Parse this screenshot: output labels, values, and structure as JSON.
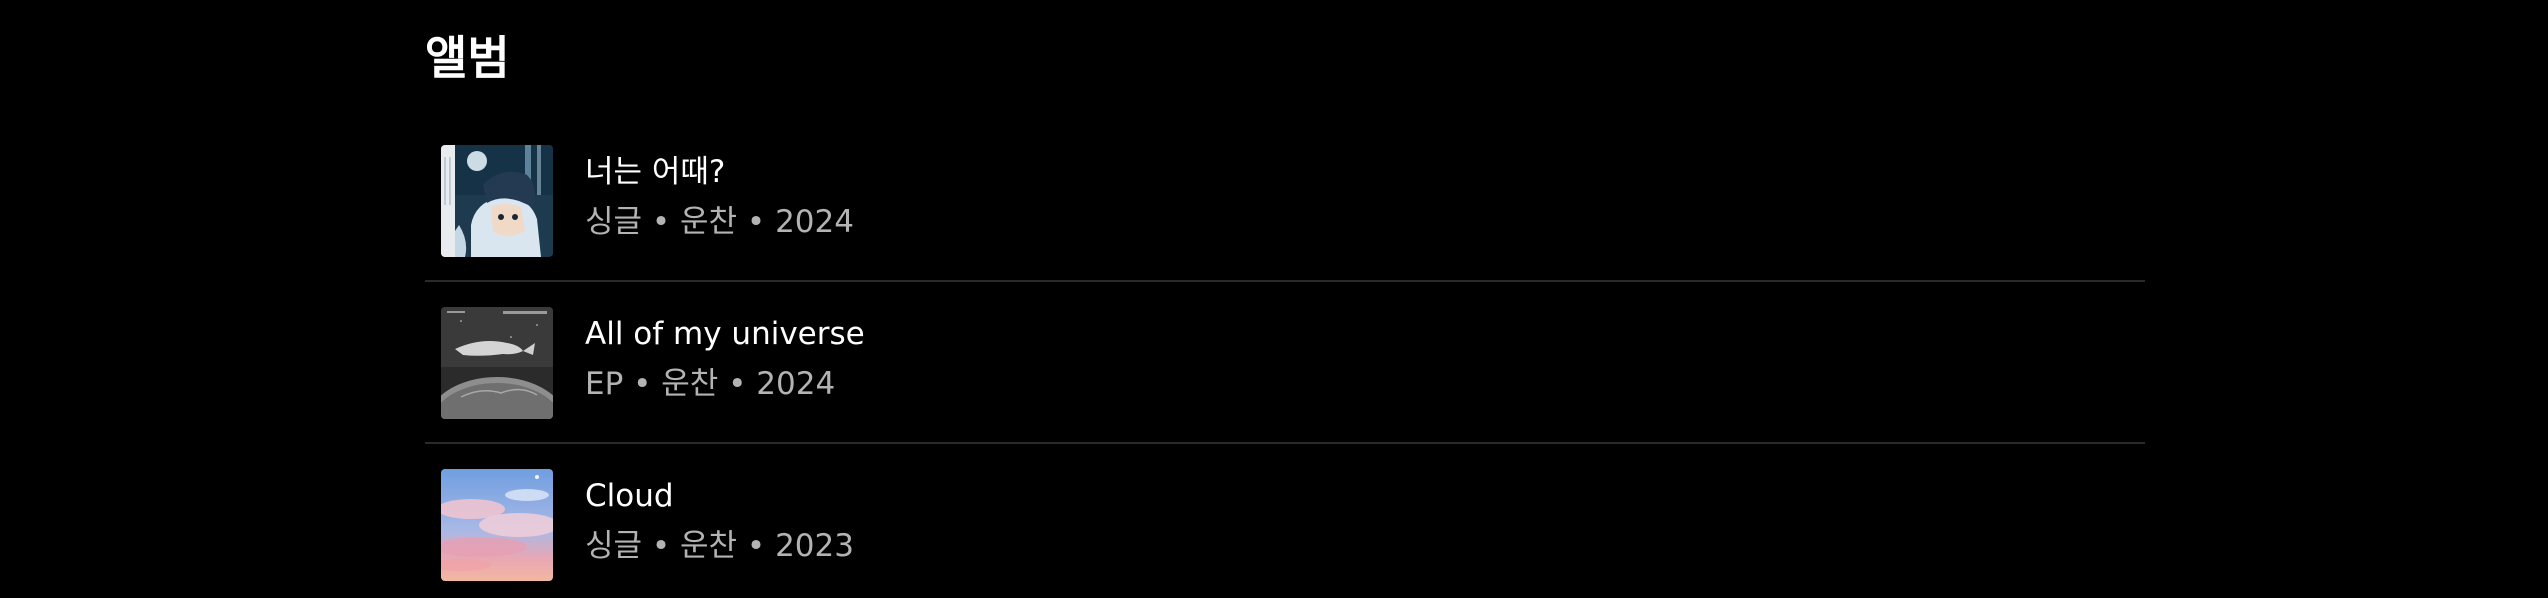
{
  "section": {
    "title": "앨범"
  },
  "albums": [
    {
      "title": "너는 어때?",
      "meta": "싱글 • 운찬 • 2024",
      "cover_icon": "anime-character-cover"
    },
    {
      "title": "All of my universe",
      "meta": "EP • 운찬 • 2024",
      "cover_icon": "whale-over-planet-cover"
    },
    {
      "title": "Cloud",
      "meta": "싱글 • 운찬 • 2023",
      "cover_icon": "sunset-clouds-cover"
    }
  ],
  "colors": {
    "background": "#000000",
    "title_text": "#ffffff",
    "meta_text": "#b3b3b3",
    "divider": "#2a2a2a"
  }
}
